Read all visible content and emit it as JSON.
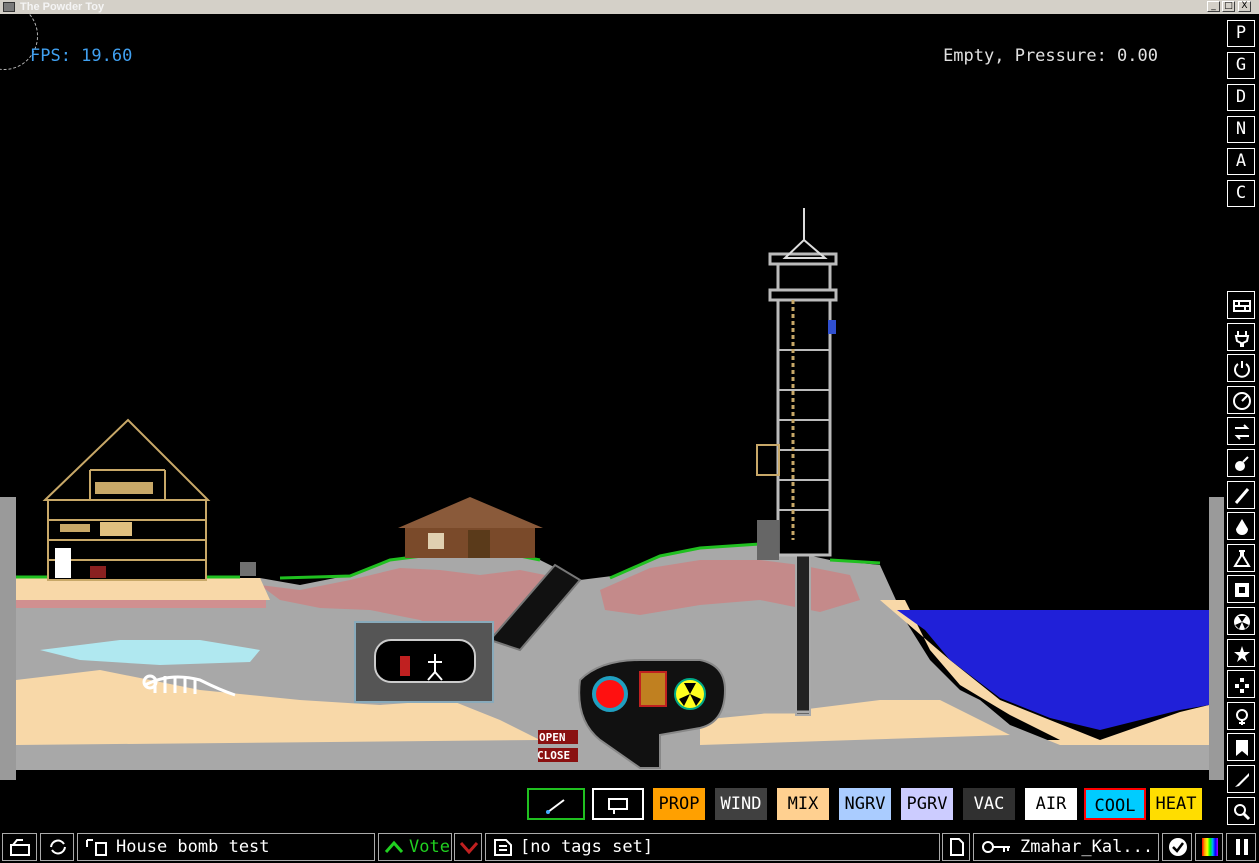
{
  "window": {
    "title": "The Powder Toy",
    "minimize": "_",
    "maximize": "□",
    "close": "X"
  },
  "hud": {
    "fps": "FPS: 19.60",
    "status": "Empty, Pressure: 0.00"
  },
  "sidebar": {
    "options": [
      "P",
      "G",
      "D",
      "N",
      "A",
      "C"
    ],
    "categories": [
      {
        "name": "walls-icon"
      },
      {
        "name": "electronics-icon"
      },
      {
        "name": "powered-icon"
      },
      {
        "name": "sensors-icon"
      },
      {
        "name": "force-icon"
      },
      {
        "name": "explosives-icon"
      },
      {
        "name": "gases-icon"
      },
      {
        "name": "liquids-icon"
      },
      {
        "name": "powders-icon"
      },
      {
        "name": "solids-icon"
      },
      {
        "name": "radioactive-icon"
      },
      {
        "name": "special-icon"
      },
      {
        "name": "life-icon"
      },
      {
        "name": "tools-icon"
      },
      {
        "name": "favorites-icon"
      },
      {
        "name": "decoration-icon"
      },
      {
        "name": "search-icon"
      }
    ]
  },
  "tools": {
    "items": [
      {
        "label": "PROP",
        "bg": "#ffa000",
        "fg": "#000000"
      },
      {
        "label": "WIND",
        "bg": "#404040",
        "fg": "#ffffff"
      },
      {
        "label": "MIX",
        "bg": "#ffd090",
        "fg": "#000000"
      },
      {
        "label": "NGRV",
        "bg": "#aaccff",
        "fg": "#000000"
      },
      {
        "label": "PGRV",
        "bg": "#ccccff",
        "fg": "#000000"
      },
      {
        "label": "VAC",
        "bg": "#303030",
        "fg": "#ffffff"
      },
      {
        "label": "AIR",
        "bg": "#ffffff",
        "fg": "#000000"
      },
      {
        "label": "COOL",
        "bg": "#00ccff",
        "fg": "#000000",
        "selected": true
      },
      {
        "label": "HEAT",
        "bg": "#ffdd00",
        "fg": "#000000"
      }
    ]
  },
  "bottombar": {
    "save_title": "House bomb test",
    "vote_label": "Vote",
    "tags": "[no tags set]",
    "username": "Zmahar_Kal..."
  },
  "scene": {
    "open_label": "OPEN",
    "close_label": "CLOSE"
  },
  "colors": {
    "fps": "#40a0f0",
    "selection": "#ff0000",
    "highlight": "#00c000",
    "water": "#2020d8",
    "sand": "#f8d8a8",
    "stone": "#a8a8a8"
  }
}
